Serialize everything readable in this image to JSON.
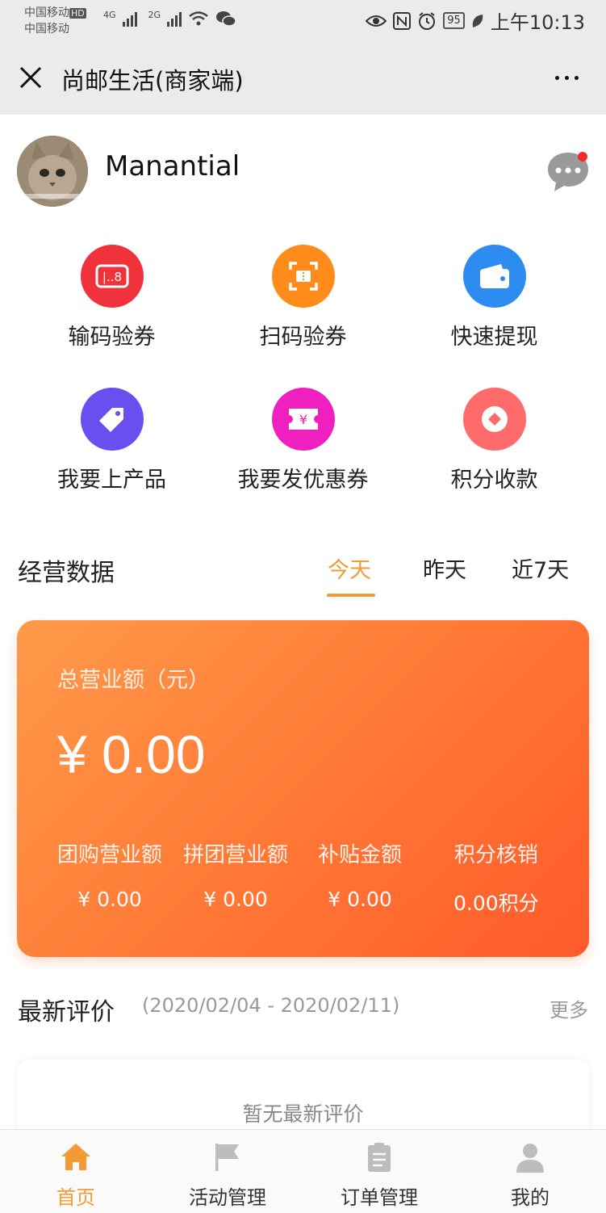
{
  "status_bar": {
    "carrier_1": "中国移动",
    "carrier_2": "中国移动",
    "hd": "HD",
    "net_1": "4G",
    "net_2": "2G",
    "battery": "95",
    "time": "上午10:13"
  },
  "titlebar": {
    "title": "尚邮生活(商家端)"
  },
  "profile": {
    "username": "Manantial"
  },
  "grid": {
    "items": [
      {
        "label": "输码验券",
        "color": "#f0323a",
        "icon": "code-input-icon"
      },
      {
        "label": "扫码验券",
        "color": "#ff8c1a",
        "icon": "scan-icon"
      },
      {
        "label": "快速提现",
        "color": "#2e8cf0",
        "icon": "wallet-icon"
      },
      {
        "label": "我要上产品",
        "color": "#6b4ef0",
        "icon": "tag-icon"
      },
      {
        "label": "我要发优惠券",
        "color": "#f01fc0",
        "icon": "coupon-icon"
      },
      {
        "label": "积分收款",
        "color": "#ff6b6b",
        "icon": "points-icon"
      }
    ]
  },
  "business": {
    "title": "经营数据",
    "tabs": [
      "今天",
      "昨天",
      "近7天"
    ],
    "active_tab": "今天",
    "total_label": "总营业额（元）",
    "total_value": "¥ 0.00",
    "stats": [
      {
        "label": "团购营业额",
        "value": "¥ 0.00"
      },
      {
        "label": "拼团营业额",
        "value": "¥ 0.00"
      },
      {
        "label": "补贴金额",
        "value": "¥ 0.00"
      },
      {
        "label": "积分核销",
        "value": "0.00积分"
      }
    ]
  },
  "reviews": {
    "title": "最新评价",
    "range": "(2020/02/04 - 2020/02/11)",
    "more": "更多",
    "empty": "暂无最新评价"
  },
  "bottom_nav": {
    "items": [
      {
        "label": "首页",
        "icon": "home-icon",
        "active": true
      },
      {
        "label": "活动管理",
        "icon": "flag-icon",
        "active": false
      },
      {
        "label": "订单管理",
        "icon": "clipboard-icon",
        "active": false
      },
      {
        "label": "我的",
        "icon": "user-icon",
        "active": false
      }
    ],
    "active_color": "#f39a35"
  }
}
